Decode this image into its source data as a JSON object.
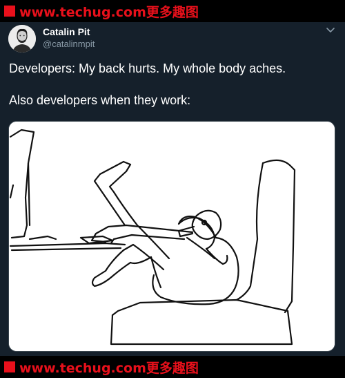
{
  "banner": {
    "text": "www.techug.com更多趣图",
    "color": "#e8101b"
  },
  "tweet": {
    "author_name": "Catalin Pit",
    "author_handle": "@catalinmpit",
    "lines": [
      "Developers: My back hurts. My whole body aches.",
      "Also developers when they work:"
    ],
    "background": "#15202b",
    "menu_icon": "chevron-down-icon"
  },
  "media": {
    "description_icon": "developer-contorted-in-chair-drawing"
  }
}
